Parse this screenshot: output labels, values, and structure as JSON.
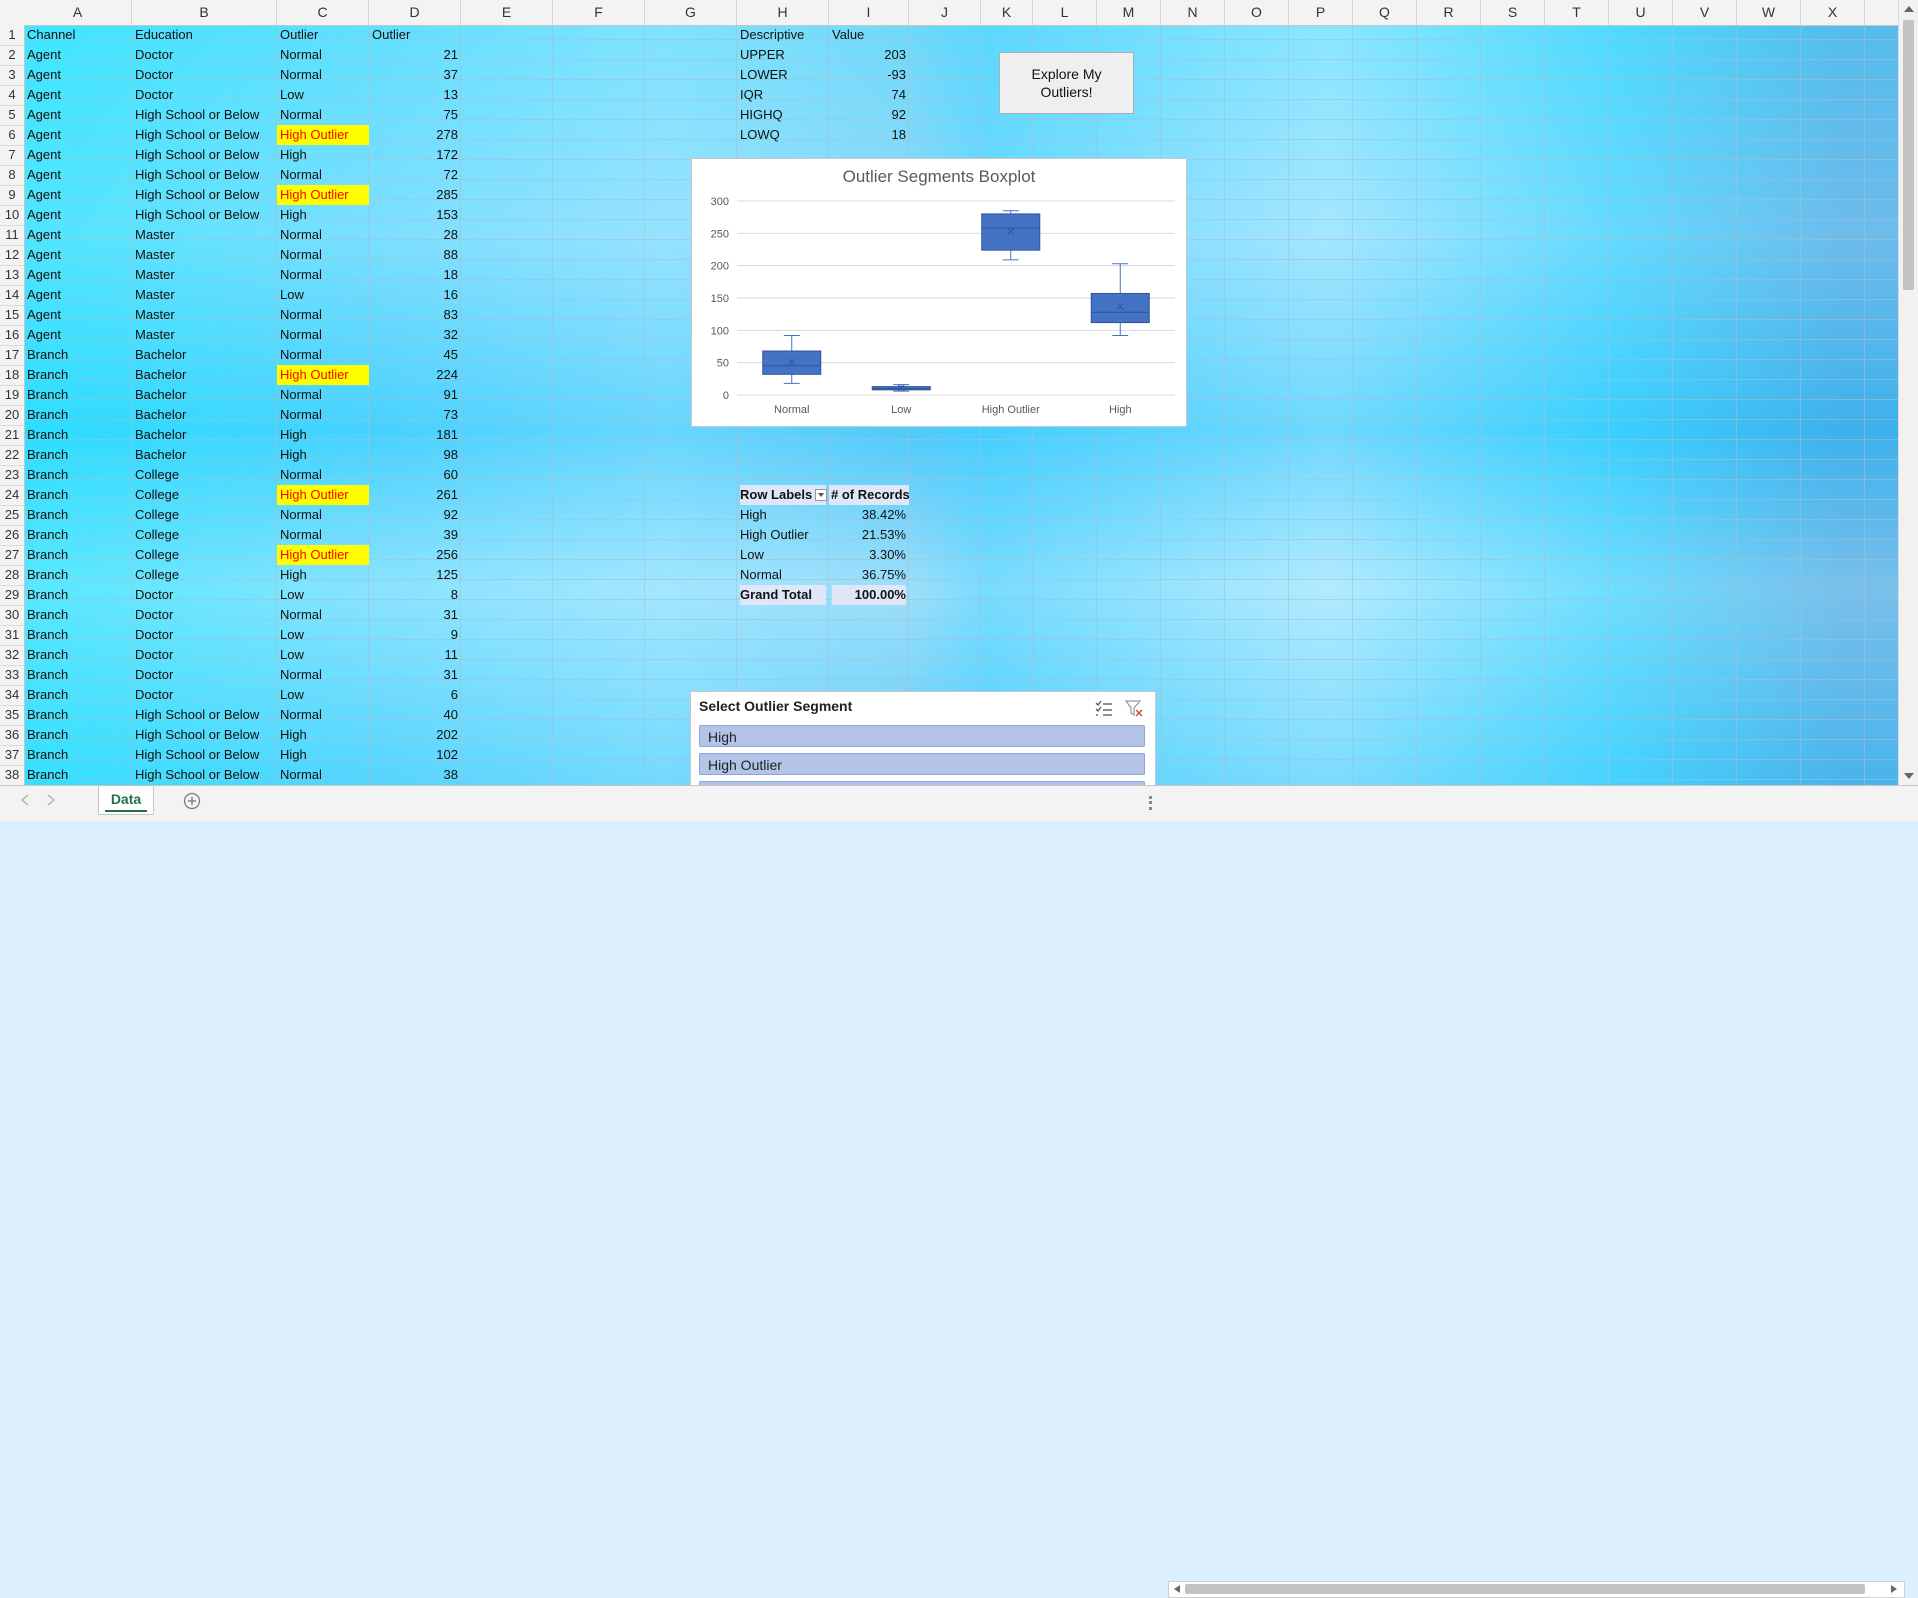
{
  "columns": [
    "A",
    "B",
    "C",
    "D",
    "E",
    "F",
    "G",
    "H",
    "I",
    "J",
    "K",
    "L",
    "M",
    "N",
    "O",
    "P",
    "Q",
    "R",
    "S",
    "T",
    "U",
    "V",
    "W",
    "X"
  ],
  "rows": [
    "1",
    "2",
    "3",
    "4",
    "5",
    "6",
    "7",
    "8",
    "9",
    "10",
    "11",
    "12",
    "13",
    "14",
    "15",
    "16",
    "17",
    "18",
    "19",
    "20",
    "21",
    "22",
    "23",
    "24",
    "25",
    "26",
    "27",
    "28",
    "29",
    "30",
    "31",
    "32",
    "33",
    "34",
    "35",
    "36",
    "37",
    "38"
  ],
  "table": {
    "headers": [
      "Channel",
      "Education",
      "Outlier",
      "Outlier"
    ],
    "rows": [
      [
        "Agent",
        "Doctor",
        "Normal",
        "21"
      ],
      [
        "Agent",
        "Doctor",
        "Normal",
        "37"
      ],
      [
        "Agent",
        "Doctor",
        "Low",
        "13"
      ],
      [
        "Agent",
        "High School or Below",
        "Normal",
        "75"
      ],
      [
        "Agent",
        "High School or Below",
        "High Outlier",
        "278"
      ],
      [
        "Agent",
        "High School or Below",
        "High",
        "172"
      ],
      [
        "Agent",
        "High School or Below",
        "Normal",
        "72"
      ],
      [
        "Agent",
        "High School or Below",
        "High Outlier",
        "285"
      ],
      [
        "Agent",
        "High School or Below",
        "High",
        "153"
      ],
      [
        "Agent",
        "Master",
        "Normal",
        "28"
      ],
      [
        "Agent",
        "Master",
        "Normal",
        "88"
      ],
      [
        "Agent",
        "Master",
        "Normal",
        "18"
      ],
      [
        "Agent",
        "Master",
        "Low",
        "16"
      ],
      [
        "Agent",
        "Master",
        "Normal",
        "83"
      ],
      [
        "Agent",
        "Master",
        "Normal",
        "32"
      ],
      [
        "Branch",
        "Bachelor",
        "Normal",
        "45"
      ],
      [
        "Branch",
        "Bachelor",
        "High Outlier",
        "224"
      ],
      [
        "Branch",
        "Bachelor",
        "Normal",
        "91"
      ],
      [
        "Branch",
        "Bachelor",
        "Normal",
        "73"
      ],
      [
        "Branch",
        "Bachelor",
        "High",
        "181"
      ],
      [
        "Branch",
        "Bachelor",
        "High",
        "98"
      ],
      [
        "Branch",
        "College",
        "Normal",
        "60"
      ],
      [
        "Branch",
        "College",
        "High Outlier",
        "261"
      ],
      [
        "Branch",
        "College",
        "Normal",
        "92"
      ],
      [
        "Branch",
        "College",
        "Normal",
        "39"
      ],
      [
        "Branch",
        "College",
        "High Outlier",
        "256"
      ],
      [
        "Branch",
        "College",
        "High",
        "125"
      ],
      [
        "Branch",
        "Doctor",
        "Low",
        "8"
      ],
      [
        "Branch",
        "Doctor",
        "Normal",
        "31"
      ],
      [
        "Branch",
        "Doctor",
        "Low",
        "9"
      ],
      [
        "Branch",
        "Doctor",
        "Low",
        "11"
      ],
      [
        "Branch",
        "Doctor",
        "Normal",
        "31"
      ],
      [
        "Branch",
        "Doctor",
        "Low",
        "6"
      ],
      [
        "Branch",
        "High School or Below",
        "Normal",
        "40"
      ],
      [
        "Branch",
        "High School or Below",
        "High",
        "202"
      ],
      [
        "Branch",
        "High School or Below",
        "High",
        "102"
      ],
      [
        "Branch",
        "High School or Below",
        "Normal",
        "38"
      ]
    ]
  },
  "descriptive": {
    "headers": [
      "Descriptive",
      "Value"
    ],
    "rows": [
      [
        "UPPER",
        "203"
      ],
      [
        "LOWER",
        "-93"
      ],
      [
        "IQR",
        "74"
      ],
      [
        "HIGHQ",
        "92"
      ],
      [
        "LOWQ",
        "18"
      ]
    ]
  },
  "button": {
    "label_line1": "Explore My",
    "label_line2": "Outliers!"
  },
  "pivot": {
    "header_labels": "Row Labels",
    "header_count": "# of Records",
    "rows": [
      [
        "High",
        "38.42%"
      ],
      [
        "High Outlier",
        "21.53%"
      ],
      [
        "Low",
        "3.30%"
      ],
      [
        "Normal",
        "36.75%"
      ]
    ],
    "total": [
      "Grand Total",
      "100.00%"
    ]
  },
  "slicer": {
    "title": "Select Outlier Segment",
    "items": [
      "High",
      "High Outlier"
    ]
  },
  "sheet_tab": "Data",
  "chart_data": {
    "type": "boxplot",
    "title": "Outlier Segments Boxplot",
    "categories": [
      "Normal",
      "Low",
      "High Outlier",
      "High"
    ],
    "ylim": [
      0,
      300
    ],
    "yticks": [
      "0",
      "50",
      "100",
      "150",
      "200",
      "250",
      "300"
    ],
    "boxes": [
      {
        "min": 18,
        "q1": 32,
        "median": 45,
        "q3": 68,
        "max": 92,
        "mean": 51
      },
      {
        "min": 6,
        "q1": 8,
        "median": 10,
        "q3": 13,
        "max": 16,
        "mean": 11
      },
      {
        "min": 209,
        "q1": 224,
        "median": 258,
        "q3": 280,
        "max": 285,
        "mean": 253
      },
      {
        "min": 92,
        "q1": 112,
        "median": 128,
        "q3": 157,
        "max": 203,
        "mean": 137
      }
    ],
    "grid": true,
    "color": "#4472c4"
  }
}
